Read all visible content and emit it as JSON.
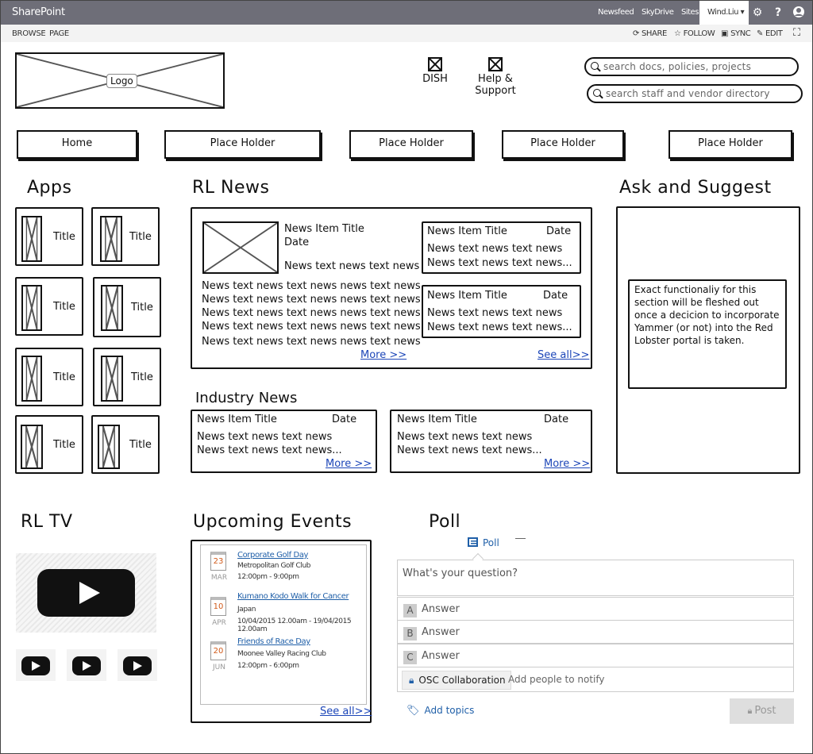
{
  "topbar": {
    "brand": "SharePoint",
    "links": [
      "Newsfeed",
      "SkyDrive",
      "Sites"
    ],
    "user": "Wind.Liu ▾",
    "icons": [
      "gear-icon",
      "help-icon",
      "user-avatar-icon"
    ]
  },
  "ribbon": {
    "tabs": [
      "BROWSE",
      "PAGE"
    ],
    "actions": [
      "SHARE",
      "FOLLOW",
      "SYNC",
      "EDIT"
    ]
  },
  "header": {
    "logo_label": "Logo",
    "links": [
      "DISH",
      "Help & Support"
    ],
    "search_docs_placeholder": "search docs, policies, projects",
    "search_staff_placeholder": "search staff and vendor directory"
  },
  "nav": [
    "Home",
    "Place Holder",
    "Place Holder",
    "Place Holder",
    "Place Holder"
  ],
  "apps": {
    "title": "Apps",
    "tiles": [
      "Title",
      "Title",
      "Title",
      "Title",
      "Title",
      "Title",
      "Title",
      "Title"
    ]
  },
  "rl_news": {
    "title": "RL News",
    "featured": {
      "title": "News Item Title",
      "date": "Date",
      "intro": "News text news text news",
      "body": [
        "News text news text news news text news",
        "News text news text news news text news",
        "News text news text news news text news",
        "News text news text news news text news",
        "News text news text news news text news"
      ],
      "more": "More >>"
    },
    "items": [
      {
        "title": "News Item Title",
        "date": "Date",
        "line1": "News text news text news",
        "line2": "News text news text news..."
      },
      {
        "title": "News Item Title",
        "date": "Date",
        "line1": "News text news text news",
        "line2": "News text news text news..."
      }
    ],
    "see_all": "See all>>"
  },
  "industry_news": {
    "title": "Industry News",
    "items": [
      {
        "title": "News Item Title",
        "date": "Date",
        "line1": "News text news text news",
        "line2": "News text news text news...",
        "more": "More >>"
      },
      {
        "title": "News Item Title",
        "date": "Date",
        "line1": "News text news text news",
        "line2": "News text news text news...",
        "more": "More >>"
      }
    ]
  },
  "ask": {
    "title": "Ask and Suggest",
    "note": "Exact functionaliy for this section will be fleshed out once a decicion to incorporate Yammer (or not) into the Red Lobster portal is taken."
  },
  "rltv": {
    "title": "RL TV"
  },
  "events": {
    "title": "Upcoming Events",
    "items": [
      {
        "day": "23",
        "month": "MAR",
        "title": "Corporate Golf Day",
        "place": "Metropolitan Golf Club",
        "time": "12:00pm - 9:00pm"
      },
      {
        "day": "10",
        "month": "APR",
        "title": "Kumano Kodo Walk for Cancer",
        "place": "Japan",
        "time": "10/04/2015 12.00am - 19/04/2015 12.00am"
      },
      {
        "day": "20",
        "month": "JUN",
        "title": "Friends of  Race Day",
        "place": "Moonee Valley Racing Club",
        "time": "12:00pm - 6:00pm"
      }
    ],
    "see_all": "See all>>"
  },
  "poll": {
    "title": "Poll",
    "tab": "Poll",
    "question_placeholder": "What's your question?",
    "answers": [
      {
        "letter": "A",
        "text": "Answer"
      },
      {
        "letter": "B",
        "text": "Answer"
      },
      {
        "letter": "C",
        "text": "Answer"
      }
    ],
    "group": "OSC Collaboration",
    "notify_placeholder": "Add people to notify",
    "add_topics": "Add topics",
    "post": "Post"
  }
}
